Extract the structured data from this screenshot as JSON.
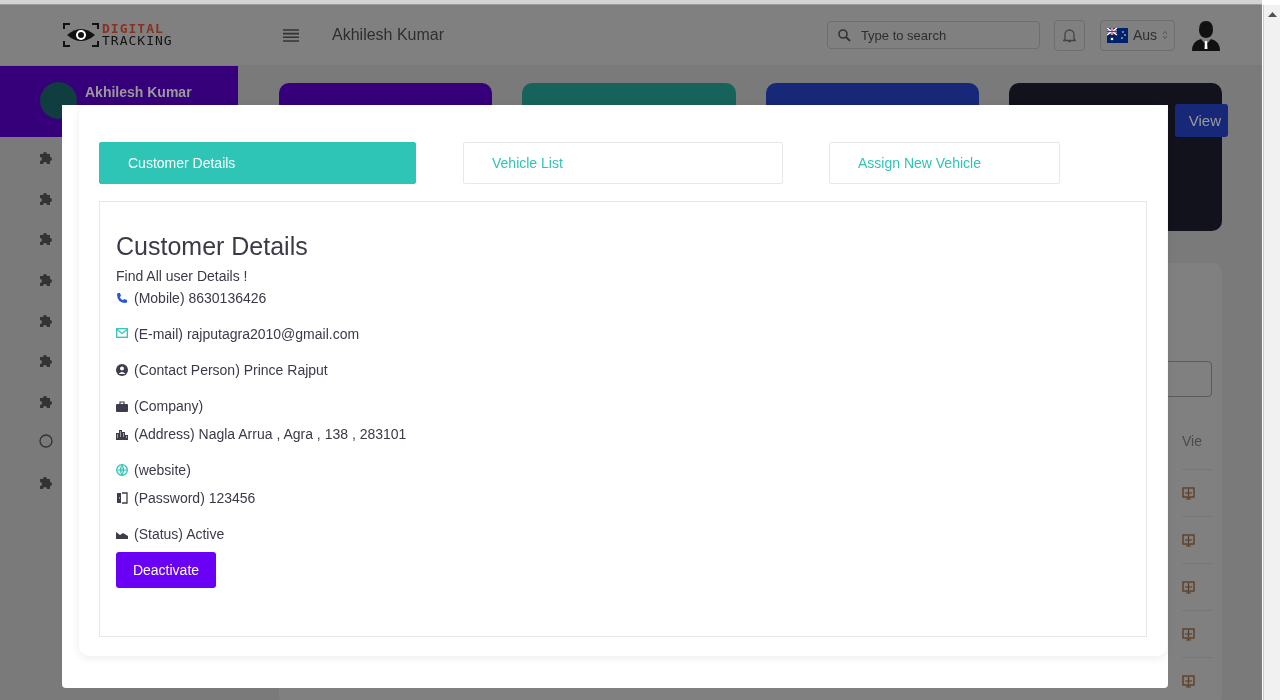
{
  "header": {
    "logo": {
      "line1": "DIGITAL",
      "line2": "TRACKING"
    },
    "title": "Akhilesh Kumar",
    "search": {
      "placeholder": "Type to search"
    },
    "language": "Aus"
  },
  "sidebar": {
    "user_name": "Akhilesh Kumar",
    "items": [
      {
        "kind": "puzzle"
      },
      {
        "kind": "puzzle"
      },
      {
        "kind": "puzzle"
      },
      {
        "kind": "puzzle"
      },
      {
        "kind": "puzzle"
      },
      {
        "kind": "puzzle"
      },
      {
        "kind": "puzzle"
      },
      {
        "kind": "circle"
      },
      {
        "kind": "puzzle"
      }
    ]
  },
  "stat_cards": [
    {
      "color": "#35007a"
    },
    {
      "color": "#17625a"
    },
    {
      "color": "#182878"
    },
    {
      "color": "#12121d"
    }
  ],
  "view_button": "View",
  "table": {
    "column": "Vie"
  },
  "modal": {
    "tabs": [
      {
        "label": "Customer Details",
        "selected": true
      },
      {
        "label": "Vehicle List",
        "selected": false
      },
      {
        "label": "Assign New Vehicle",
        "selected": false
      }
    ],
    "title": "Customer Details",
    "subtitle": "Find All user Details !",
    "details": [
      {
        "kind": "mobile",
        "text": "(Mobile) 8630136426"
      },
      {
        "kind": "email",
        "text": "(E-mail) rajputagra2010@gmail.com"
      },
      {
        "kind": "person",
        "text": "(Contact Person) Prince Rajput"
      },
      {
        "kind": "company",
        "text": "(Company)"
      },
      {
        "kind": "address",
        "text": "(Address) Nagla Arrua , Agra , 138 , 283101"
      },
      {
        "kind": "website",
        "text": "(website)"
      },
      {
        "kind": "password",
        "text": "(Password) 123456"
      },
      {
        "kind": "status",
        "text": "(Status) Active"
      }
    ],
    "button": "Deactivate"
  }
}
